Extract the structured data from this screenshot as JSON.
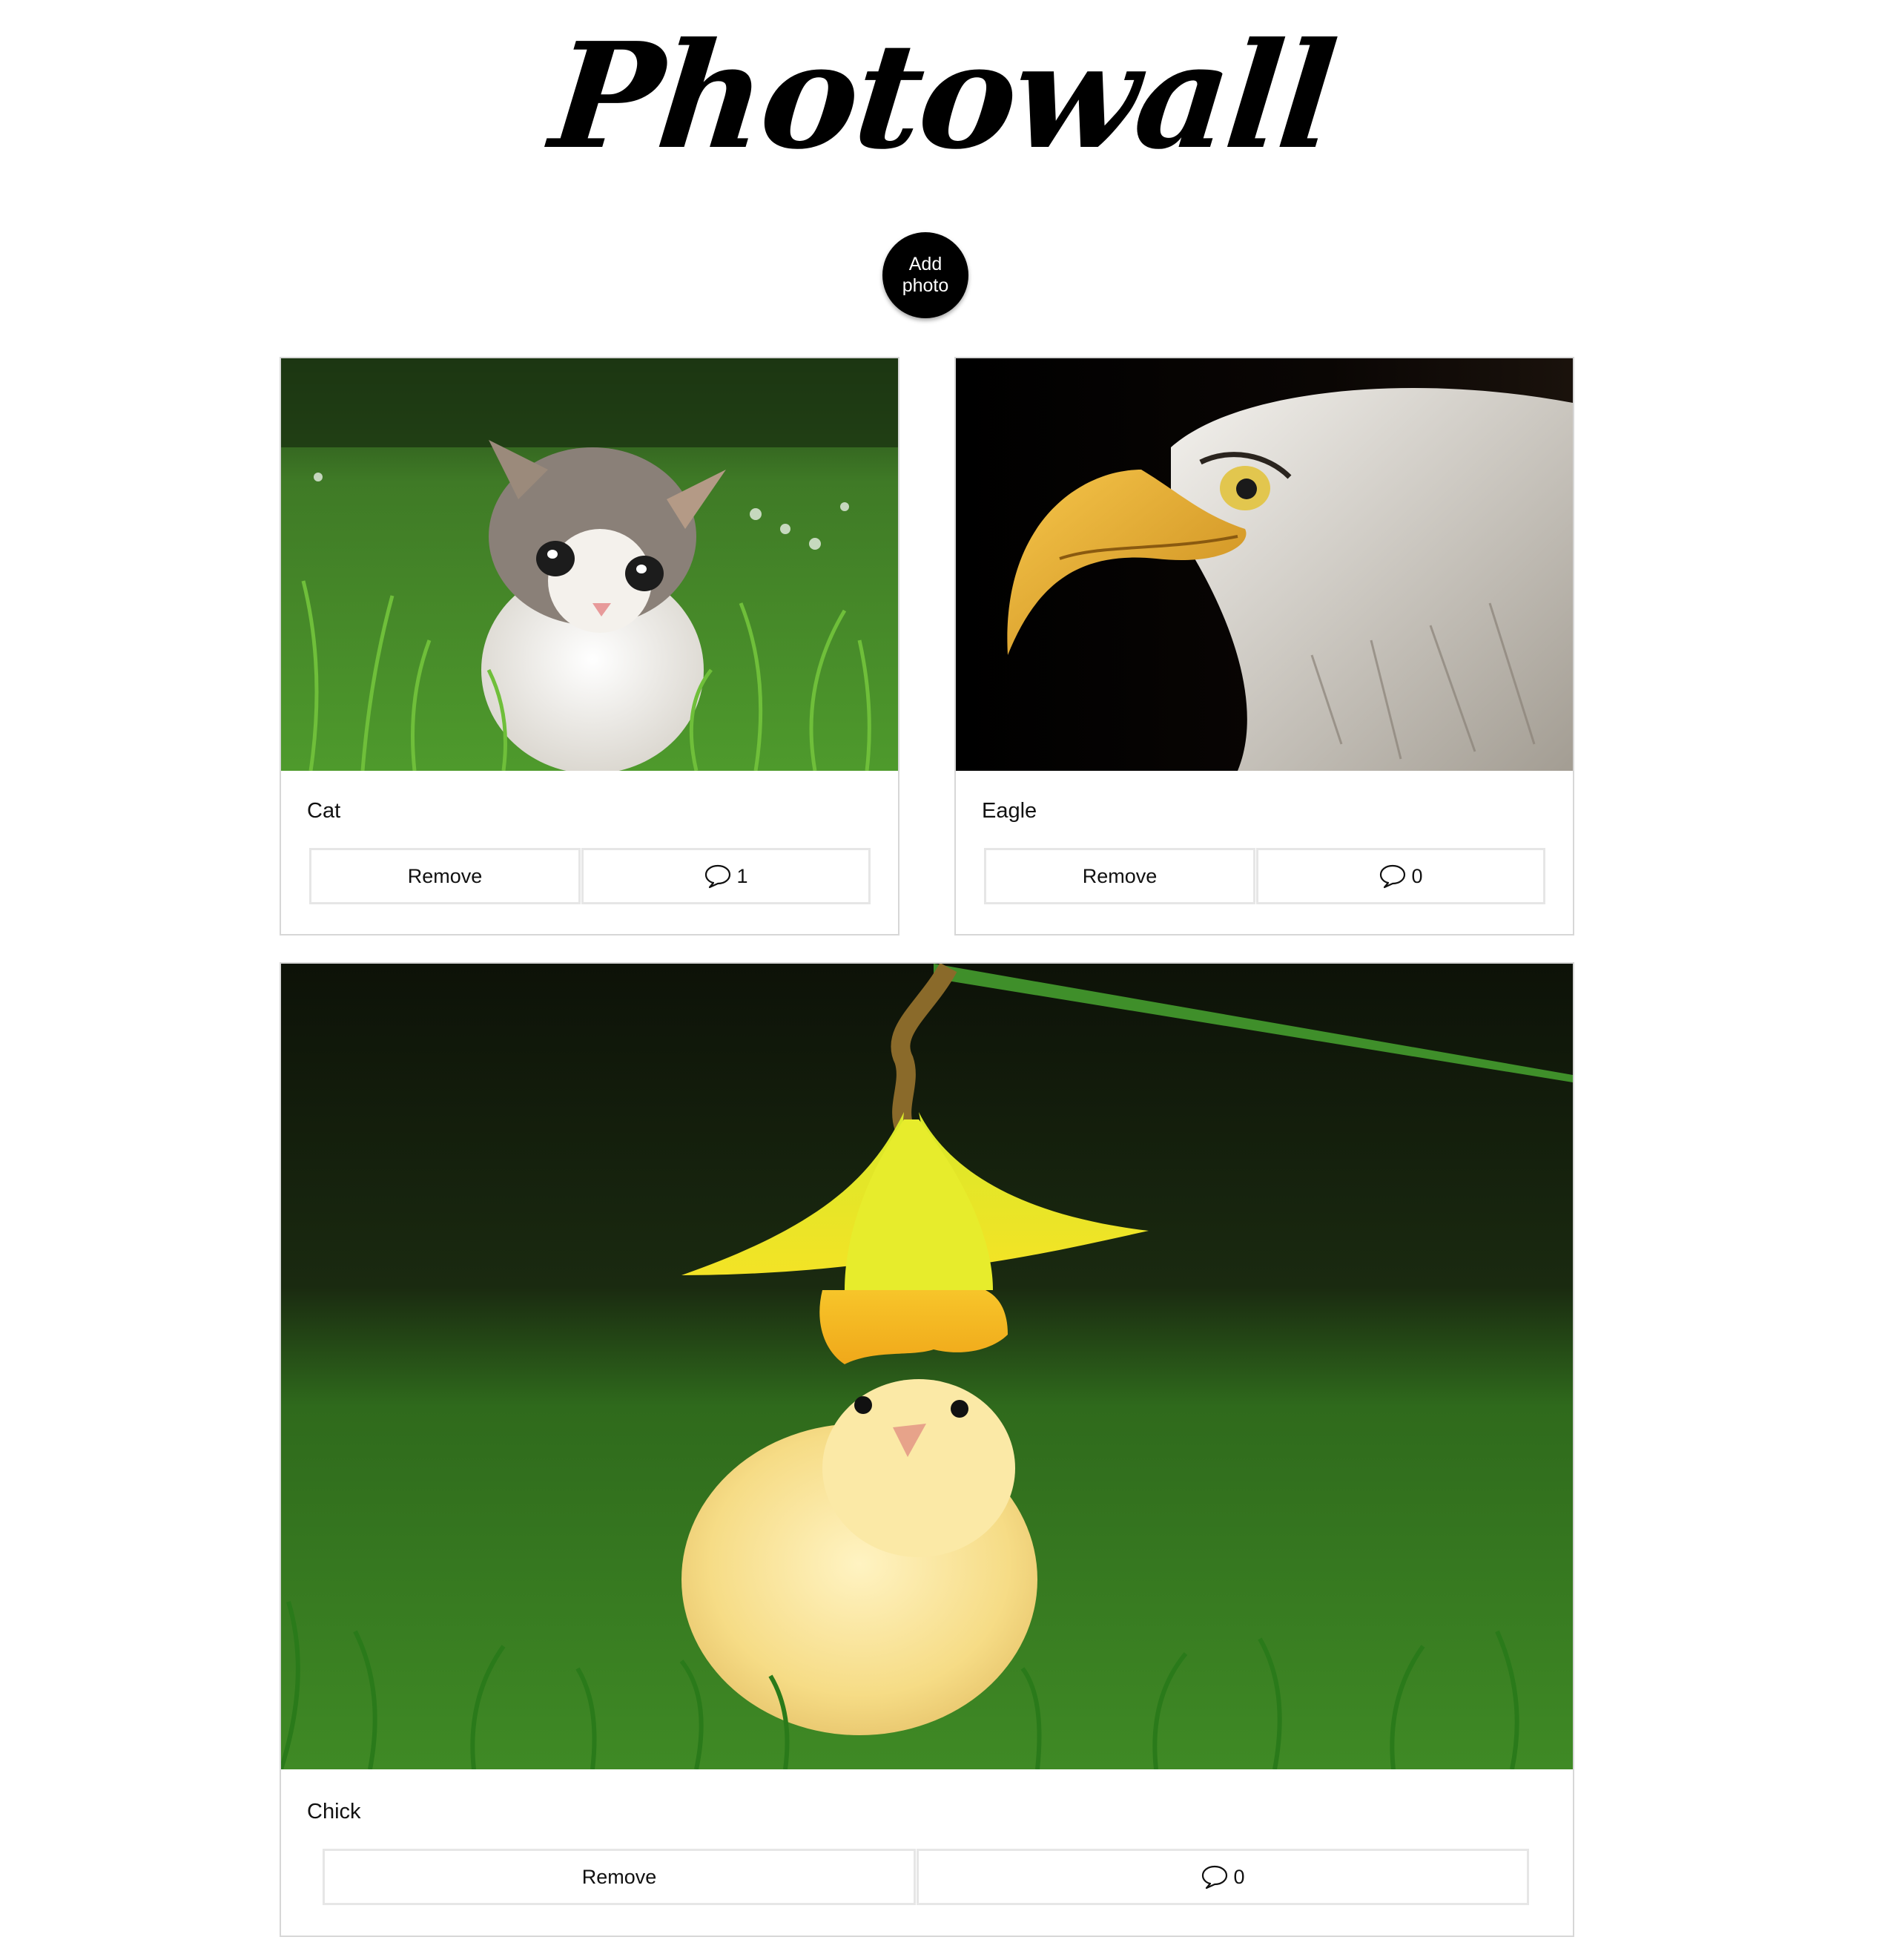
{
  "header": {
    "title": "Photowall",
    "add_button_label": "Add photo"
  },
  "icons": {
    "comment": "speech-bubble-icon"
  },
  "posts": [
    {
      "caption": "Cat",
      "remove_label": "Remove",
      "comment_count": "1",
      "image": "kitten-in-grass-photo"
    },
    {
      "caption": "Eagle",
      "remove_label": "Remove",
      "comment_count": "0",
      "image": "bald-eagle-head-photo"
    },
    {
      "caption": "Chick",
      "remove_label": "Remove",
      "comment_count": "0",
      "image": "chick-under-daffodil-photo"
    }
  ],
  "colors": {
    "background": "#ffffff",
    "button_bg": "#000000",
    "button_text": "#ffffff",
    "card_border": "#d7d7d7",
    "button_border": "#e6e6e6"
  }
}
